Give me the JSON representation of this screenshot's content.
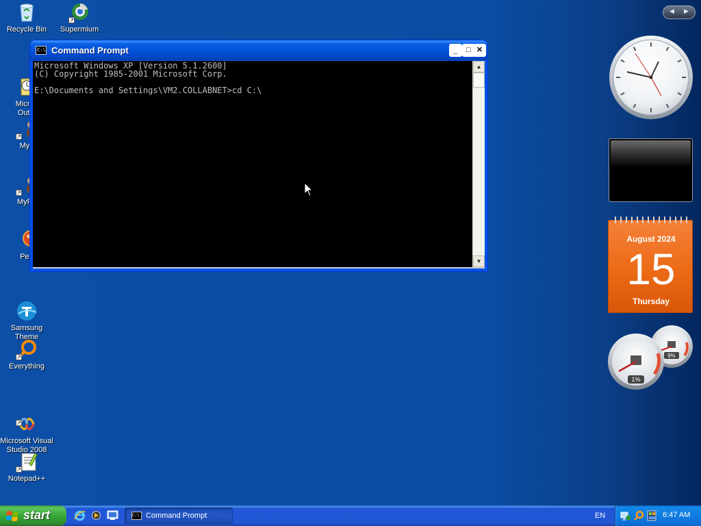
{
  "desktop": {
    "icons": [
      {
        "label": "Recycle Bin"
      },
      {
        "label": "Supermium"
      },
      {
        "label": "Micros\nOutlo"
      },
      {
        "label": "Myp"
      },
      {
        "label": "MyPa"
      },
      {
        "label": "Peg"
      },
      {
        "label": "Samsung\nTheme"
      },
      {
        "label": "Everything"
      },
      {
        "label": "Microsoft Visual\nStudio 2008"
      },
      {
        "label": "Notepad++"
      }
    ]
  },
  "cmd_window": {
    "title": "Command Prompt",
    "icon_text": "C:\\",
    "minimize": "_",
    "maximize": "□",
    "close": "✕",
    "console_lines": [
      "Microsoft Windows XP [Version 5.1.2600]",
      "(C) Copyright 1985-2001 Microsoft Corp.",
      "",
      "E:\\Documents and Settings\\VM2.COLLABNET>cd C:\\"
    ],
    "scroll_up": "▲",
    "scroll_down": "▼"
  },
  "sidebar": {
    "nav_prev": "◀",
    "nav_next": "▶",
    "calendar": {
      "month_year": "August 2024",
      "day": "15",
      "weekday": "Thursday"
    },
    "meters": {
      "cpu_label": "1%",
      "memory_label": "9%",
      "cpu_value": 1,
      "memory_value": 9
    }
  },
  "taskbar": {
    "start_label": "start",
    "task_cmd_label": "Command Prompt",
    "task_cmd_icon_text": "C:\\",
    "language": "EN",
    "clock": "6:47 AM"
  },
  "colors": {
    "desktop_bg": "#0a4fa6",
    "taskbar_bg": "#2257d6",
    "start_green": "#38a838",
    "calendar_orange": "#ea6812"
  }
}
